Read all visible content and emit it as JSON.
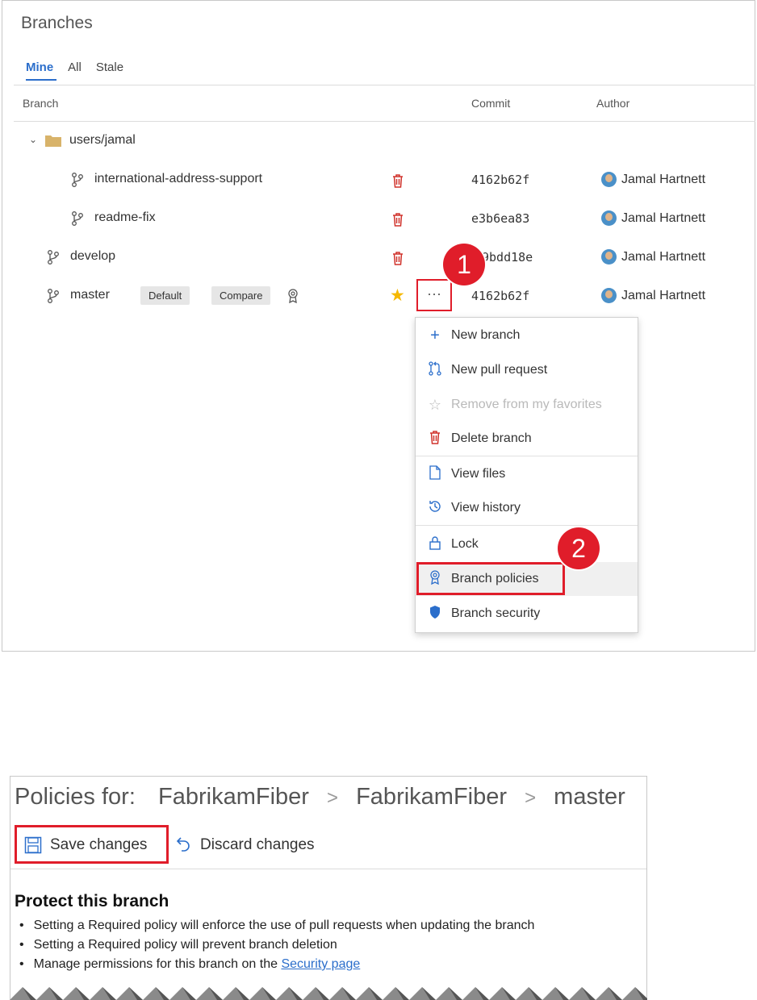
{
  "branches_panel": {
    "title": "Branches",
    "tabs": [
      {
        "label": "Mine",
        "active": true
      },
      {
        "label": "All",
        "active": false
      },
      {
        "label": "Stale",
        "active": false
      }
    ],
    "columns": {
      "branch": "Branch",
      "commit": "Commit",
      "author": "Author"
    },
    "folder": {
      "name": "users/jamal",
      "icon": "folder-icon",
      "expanded": true
    },
    "rows": [
      {
        "name": "international-address-support",
        "commit": "4162b62f",
        "author": "Jamal Hartnett",
        "nested": true
      },
      {
        "name": "readme-fix",
        "commit": "e3b6ea83",
        "author": "Jamal Hartnett",
        "nested": true
      },
      {
        "name": "develop",
        "commit": "9bdd18e",
        "author": "Jamal Hartnett",
        "nested": false
      },
      {
        "name": "master",
        "commit": "4162b62f",
        "author": "Jamal Hartnett",
        "nested": false,
        "badge_default": "Default",
        "badge_compare": "Compare",
        "favorite": true
      }
    ],
    "more_button": "···",
    "callout_1": "1",
    "callout_2": "2"
  },
  "context_menu": {
    "items": [
      {
        "label": "New branch",
        "icon": "plus-icon",
        "enabled": true
      },
      {
        "label": "New pull request",
        "icon": "pull-request-icon",
        "enabled": true
      },
      {
        "label": "Remove from my favorites",
        "icon": "star-outline-icon",
        "enabled": false
      },
      {
        "label": "Delete branch",
        "icon": "trash-icon",
        "enabled": true
      },
      {
        "label": "View files",
        "icon": "file-icon",
        "enabled": true
      },
      {
        "label": "View history",
        "icon": "history-icon",
        "enabled": true
      },
      {
        "label": "Lock",
        "icon": "lock-icon",
        "enabled": true
      },
      {
        "label": "Branch policies",
        "icon": "policy-badge-icon",
        "enabled": true,
        "highlighted": true
      },
      {
        "label": "Branch security",
        "icon": "shield-icon",
        "enabled": true
      }
    ]
  },
  "policies_panel": {
    "prefix": "Policies for:",
    "crumbs": [
      "FabrikamFiber",
      "FabrikamFiber",
      "master"
    ],
    "save_label": "Save changes",
    "discard_label": "Discard changes",
    "heading": "Protect this branch",
    "bullets": [
      "Setting a Required policy will enforce the use of pull requests when updating the branch",
      "Setting a Required policy will prevent branch deletion"
    ],
    "bullet3_prefix": "Manage permissions for this branch on the ",
    "bullet3_link": "Security page"
  },
  "colors": {
    "accent": "#2b6ecb",
    "highlight_red": "#e01d2a",
    "delete_red": "#d0322b",
    "star": "#f5b800",
    "folder": "#d8b36a"
  }
}
